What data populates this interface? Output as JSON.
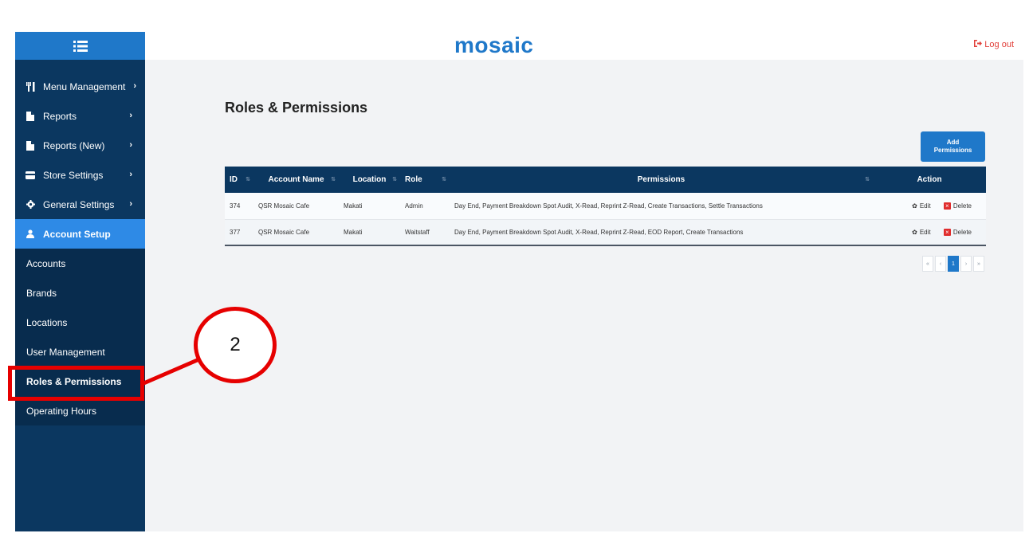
{
  "header": {
    "logo": "mosaic",
    "logout_label": "Log out"
  },
  "sidebar": {
    "menu": [
      {
        "label": "Menu Management",
        "icon": "utensils-icon",
        "chevron": "›"
      },
      {
        "label": "Reports",
        "icon": "file-icon",
        "chevron": "›"
      },
      {
        "label": "Reports (New)",
        "icon": "file-icon",
        "chevron": "›"
      },
      {
        "label": "Store Settings",
        "icon": "card-icon",
        "chevron": "›"
      },
      {
        "label": "General Settings",
        "icon": "gear-icon",
        "chevron": "›"
      },
      {
        "label": "Account Setup",
        "icon": "user-icon"
      }
    ],
    "submenu": [
      "Accounts",
      "Brands",
      "Locations",
      "User Management",
      "Roles & Permissions",
      "Operating Hours"
    ]
  },
  "main": {
    "title": "Roles & Permissions",
    "add_button": "Add Permissions",
    "table": {
      "headers": [
        "ID",
        "Account Name",
        "Location",
        "Role",
        "Permissions",
        "Action"
      ],
      "rows": [
        {
          "id": "374",
          "account": "QSR Mosaic Cafe",
          "location": "Makati",
          "role": "Admin",
          "permissions": "Day End, Payment Breakdown Spot Audit, X-Read, Reprint Z-Read, Create Transactions, Settle Transactions"
        },
        {
          "id": "377",
          "account": "QSR Mosaic Cafe",
          "location": "Makati",
          "role": "Waitstaff",
          "permissions": "Day End, Payment Breakdown Spot Audit, X-Read, Reprint Z-Read, EOD Report, Create Transactions"
        }
      ],
      "edit_label": "Edit",
      "delete_label": "Delete"
    },
    "pagination": {
      "first": "«",
      "prev": "‹",
      "current": "1",
      "next": "›",
      "last": "»"
    }
  },
  "annotation": {
    "number": "2"
  },
  "colors": {
    "sidebar": "#0b3760",
    "accent": "#1f78c9",
    "active_menu": "#2e8ae6",
    "annotation": "#e60000",
    "logout": "#e2413b"
  }
}
